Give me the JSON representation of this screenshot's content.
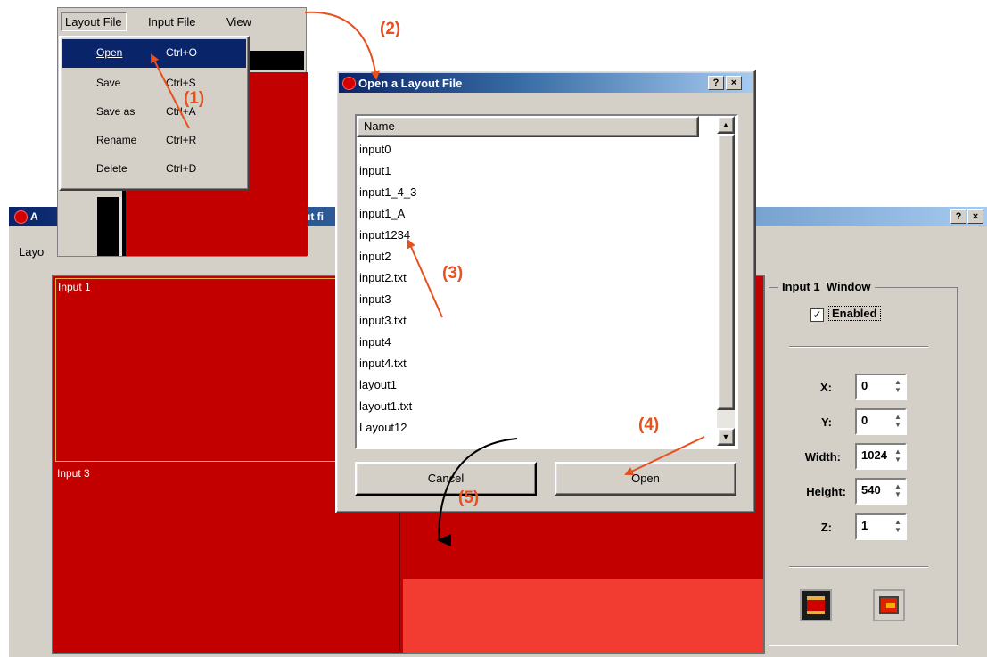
{
  "menubar": {
    "items": [
      "Layout File",
      "Input File",
      "View"
    ]
  },
  "layout_file_menu": {
    "items": [
      {
        "label": "Open",
        "shortcut": "Ctrl+O"
      },
      {
        "label": "Save",
        "shortcut": "Ctrl+S"
      },
      {
        "label": "Save as",
        "shortcut": "Ctrl+A"
      },
      {
        "label": "Rename",
        "shortcut": "Ctrl+R"
      },
      {
        "label": "Delete",
        "shortcut": "Ctrl+D"
      }
    ]
  },
  "main_window": {
    "title_left": "A",
    "title_fragment": "ut fi",
    "menu_fragment": "Layo",
    "help_btn": "?",
    "close_btn": "×",
    "regions": [
      "Input 1",
      "Input 3"
    ]
  },
  "dialog": {
    "title": "Open a Layout File",
    "help_btn": "?",
    "close_btn": "×",
    "column_header": "Name",
    "files": [
      "input0",
      "input1",
      "input1_4_3",
      "input1_A",
      "input1234",
      "input2",
      "input2.txt",
      "input3",
      "input3.txt",
      "input4",
      "input4.txt",
      "layout1",
      "layout1.txt",
      "Layout12"
    ],
    "cancel_label": "Cancel",
    "open_label": "Open"
  },
  "properties": {
    "group_title": "Input 1  Window",
    "enabled_label": "Enabled",
    "enabled_checked": true,
    "fields": [
      {
        "label": "X:",
        "value": "0"
      },
      {
        "label": "Y:",
        "value": "0"
      },
      {
        "label": "Width:",
        "value": "1024"
      },
      {
        "label": "Height:",
        "value": "540"
      },
      {
        "label": "Z:",
        "value": "1"
      }
    ]
  },
  "annotations": [
    "(1)",
    "(2)",
    "(3)",
    "(4)",
    "(5)"
  ],
  "colors": {
    "dark_red": "#c20000",
    "light_red": "#f23c32",
    "orange_arrow": "#e8501e",
    "title_blue": "#0a246a",
    "face": "#d4d0c8"
  }
}
